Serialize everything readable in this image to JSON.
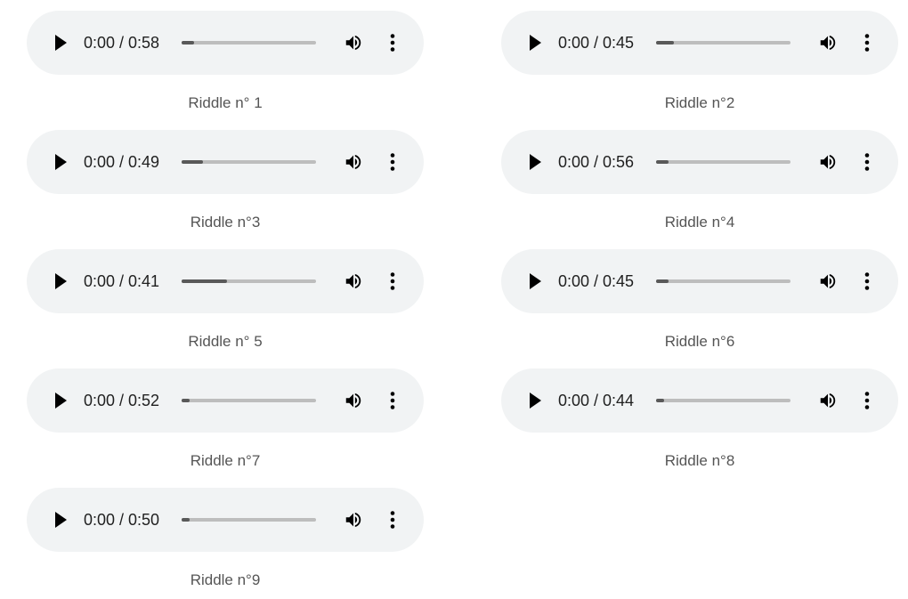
{
  "colors": {
    "player_background": "#f1f3f4",
    "progress_fill": "#595959",
    "progress_track": "#bdbdbd",
    "caption_text": "#555555",
    "time_text": "#1f1f1f"
  },
  "icons": {
    "play": "play-icon",
    "volume": "volume-icon",
    "more": "more-options-icon"
  },
  "riddles": [
    {
      "time": "0:00 / 0:58",
      "caption": "Riddle n° 1",
      "buffered": 0.09
    },
    {
      "time": "0:00 / 0:45",
      "caption": "Riddle n°2",
      "buffered": 0.13
    },
    {
      "time": "0:00 / 0:49",
      "caption": "Riddle n°3",
      "buffered": 0.16
    },
    {
      "time": "0:00 / 0:56",
      "caption": "Riddle n°4",
      "buffered": 0.09
    },
    {
      "time": "0:00 / 0:41",
      "caption": "Riddle n° 5",
      "buffered": 0.34
    },
    {
      "time": "0:00 / 0:45",
      "caption": "Riddle n°6",
      "buffered": 0.09
    },
    {
      "time": "0:00 / 0:52",
      "caption": "Riddle n°7",
      "buffered": 0.06
    },
    {
      "time": "0:00 / 0:44",
      "caption": "Riddle n°8",
      "buffered": 0.06
    },
    {
      "time": "0:00 / 0:50",
      "caption": "Riddle n°9",
      "buffered": 0.06
    }
  ]
}
